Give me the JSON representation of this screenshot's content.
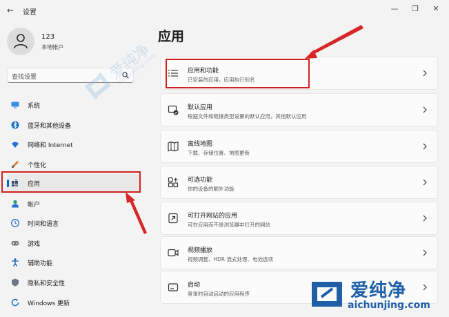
{
  "titlebar": {
    "app_title": "设置",
    "back_glyph": "←",
    "minimize_glyph": "—",
    "maximize_glyph": "❐",
    "close_glyph": "✕"
  },
  "user": {
    "name": "123",
    "account_type": "本地帐户"
  },
  "search": {
    "placeholder": "查找设置"
  },
  "sidebar": {
    "items": [
      {
        "label": "系统",
        "icon": "monitor-icon"
      },
      {
        "label": "蓝牙和其他设备",
        "icon": "bluetooth-icon"
      },
      {
        "label": "网络和 Internet",
        "icon": "wifi-icon"
      },
      {
        "label": "个性化",
        "icon": "brush-icon"
      },
      {
        "label": "应用",
        "icon": "apps-icon",
        "active": true
      },
      {
        "label": "帐户",
        "icon": "person-icon"
      },
      {
        "label": "时间和语言",
        "icon": "clock-globe-icon"
      },
      {
        "label": "游戏",
        "icon": "gamepad-icon"
      },
      {
        "label": "辅助功能",
        "icon": "accessibility-icon"
      },
      {
        "label": "隐私和安全性",
        "icon": "shield-icon"
      },
      {
        "label": "Windows 更新",
        "icon": "update-icon"
      }
    ]
  },
  "main": {
    "title": "应用",
    "cards": [
      {
        "title": "应用和功能",
        "subtitle": "已安装的应用，应用执行别名",
        "icon": "list-icon"
      },
      {
        "title": "默认应用",
        "subtitle": "根据文件和链接类型设置的默认应用，其他默认应用",
        "icon": "default-apps-icon"
      },
      {
        "title": "离线地图",
        "subtitle": "下载、存储位置、地图更新",
        "icon": "map-icon"
      },
      {
        "title": "可选功能",
        "subtitle": "你的设备的额外功能",
        "icon": "optional-features-icon"
      },
      {
        "title": "可打开网站的应用",
        "subtitle": "可在应用而不是浏览器中打开的网站",
        "icon": "open-web-icon"
      },
      {
        "title": "视频播放",
        "subtitle": "视频调整、HDR 流式处理、电池选项",
        "icon": "video-icon"
      },
      {
        "title": "启动",
        "subtitle": "登录时自动启动的应用程序",
        "icon": "startup-icon"
      }
    ]
  },
  "watermark": {
    "brand": "爱纯净",
    "domain": "aichunjing.com"
  },
  "colors": {
    "accent": "#0067c0",
    "highlight": "#d02020",
    "background": "#f3f3f3",
    "card": "#fbfbfb"
  }
}
